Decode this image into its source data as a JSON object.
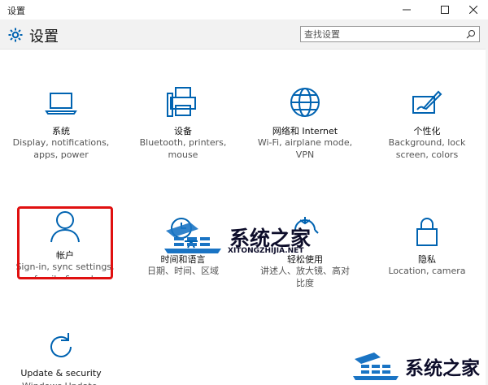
{
  "window": {
    "title": "设置"
  },
  "header": {
    "title": "设置"
  },
  "search": {
    "placeholder": "查找设置"
  },
  "tiles": [
    {
      "title": "系统",
      "desc": [
        "Display, notifications,",
        "apps, power"
      ],
      "icon": "laptop-icon"
    },
    {
      "title": "设备",
      "desc": [
        "Bluetooth, printers,",
        "mouse"
      ],
      "icon": "printer-icon"
    },
    {
      "title": "网络和 Internet",
      "desc": [
        "Wi-Fi, airplane mode,",
        "VPN"
      ],
      "icon": "globe-icon"
    },
    {
      "title": "个性化",
      "desc": [
        "Background, lock",
        "screen, colors"
      ],
      "icon": "paint-brush-icon"
    },
    {
      "title": "帐户",
      "desc": [
        "Sign-in, sync settings,",
        "family & work"
      ],
      "icon": "person-icon"
    },
    {
      "title": "时间和语言",
      "desc": [
        "日期、时间、区域"
      ],
      "icon": "clock-language-icon"
    },
    {
      "title": "轻松使用",
      "desc": [
        "讲述人、放大镜、高对",
        "比度"
      ],
      "icon": "ease-of-access-icon"
    },
    {
      "title": "隐私",
      "desc": [
        "Location, camera"
      ],
      "icon": "lock-icon"
    },
    {
      "title": "Update & security",
      "desc": [
        "Windows Update,"
      ],
      "icon": "refresh-icon"
    }
  ],
  "watermark": {
    "brand": "系统之家",
    "sub": "XITONGZHIJIA.NET"
  },
  "colors": {
    "accent": "#0063b1",
    "highlight": "#e01010"
  }
}
